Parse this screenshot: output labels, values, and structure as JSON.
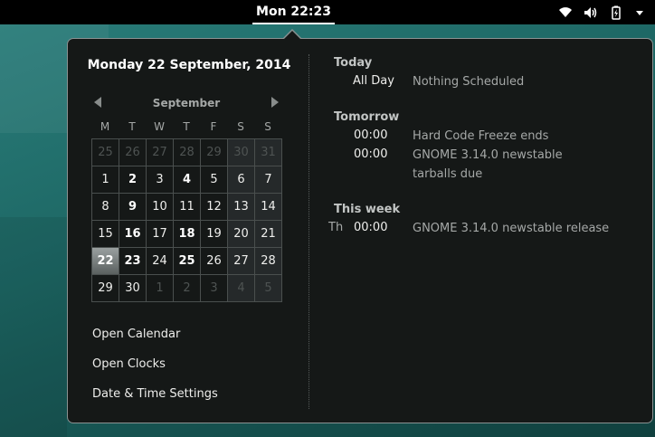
{
  "topbar": {
    "clock": "Mon 22:23",
    "icons": [
      "wifi-icon",
      "volume-icon",
      "battery-icon",
      "dropdown-arrow-icon"
    ]
  },
  "calendar": {
    "date_heading": "Monday 22 September, 2014",
    "month": "September",
    "weekdays": [
      "M",
      "T",
      "W",
      "T",
      "F",
      "S",
      "S"
    ],
    "weeks": [
      [
        {
          "d": "25",
          "o": true
        },
        {
          "d": "26",
          "o": true
        },
        {
          "d": "27",
          "o": true
        },
        {
          "d": "28",
          "o": true
        },
        {
          "d": "29",
          "o": true
        },
        {
          "d": "30",
          "o": true
        },
        {
          "d": "31",
          "o": true
        }
      ],
      [
        {
          "d": "1"
        },
        {
          "d": "2",
          "e": true
        },
        {
          "d": "3"
        },
        {
          "d": "4",
          "e": true
        },
        {
          "d": "5"
        },
        {
          "d": "6"
        },
        {
          "d": "7"
        }
      ],
      [
        {
          "d": "8"
        },
        {
          "d": "9",
          "e": true
        },
        {
          "d": "10"
        },
        {
          "d": "11"
        },
        {
          "d": "12"
        },
        {
          "d": "13"
        },
        {
          "d": "14"
        }
      ],
      [
        {
          "d": "15"
        },
        {
          "d": "16",
          "e": true
        },
        {
          "d": "17"
        },
        {
          "d": "18",
          "e": true
        },
        {
          "d": "19"
        },
        {
          "d": "20"
        },
        {
          "d": "21"
        }
      ],
      [
        {
          "d": "22",
          "t": true
        },
        {
          "d": "23",
          "e": true
        },
        {
          "d": "24"
        },
        {
          "d": "25",
          "e": true
        },
        {
          "d": "26"
        },
        {
          "d": "27"
        },
        {
          "d": "28"
        }
      ],
      [
        {
          "d": "29"
        },
        {
          "d": "30"
        },
        {
          "d": "1",
          "o": true
        },
        {
          "d": "2",
          "o": true
        },
        {
          "d": "3",
          "o": true
        },
        {
          "d": "4",
          "o": true
        },
        {
          "d": "5",
          "o": true
        }
      ]
    ]
  },
  "links": {
    "open_calendar": "Open Calendar",
    "open_clocks": "Open Clocks",
    "datetime_settings": "Date & Time Settings"
  },
  "events": {
    "today": {
      "heading": "Today",
      "items": [
        {
          "time": "All Day",
          "desc": "Nothing Scheduled"
        }
      ]
    },
    "tomorrow": {
      "heading": "Tomorrow",
      "items": [
        {
          "time": "00:00",
          "desc": "Hard Code Freeze ends"
        },
        {
          "time": "00:00",
          "desc": "GNOME 3.14.0 newstable",
          "desc2": "tarballs due"
        }
      ]
    },
    "this_week": {
      "heading": "This week",
      "items": [
        {
          "day": "Th",
          "time": "00:00",
          "desc": "GNOME 3.14.0 newstable release"
        }
      ]
    }
  }
}
